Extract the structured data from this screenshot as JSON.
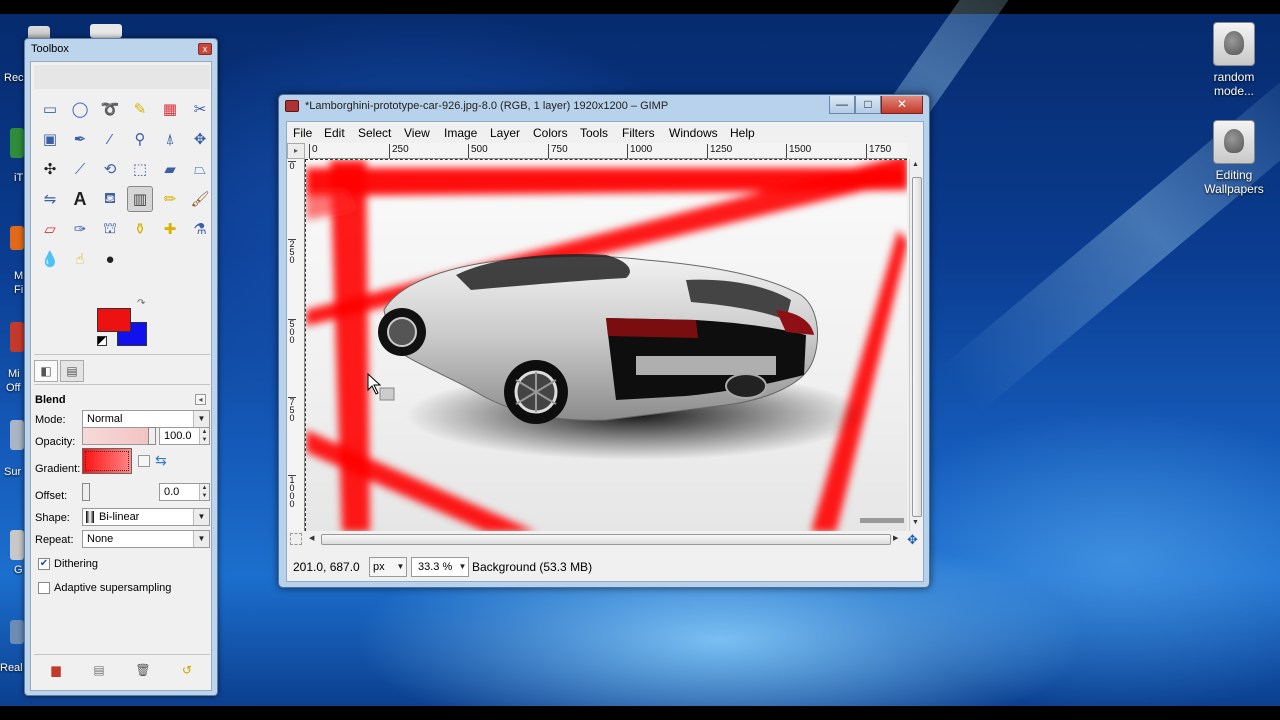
{
  "desktop": {
    "icons": [
      {
        "label_line1": "random",
        "label_line2": "mode...",
        "icon": "gimp-file-icon"
      },
      {
        "label_line1": "Editing",
        "label_line2": "Wallpapers",
        "icon": "gimp-file-icon"
      }
    ],
    "edge_labels": [
      "Rec",
      "iT",
      "M",
      "Fi",
      "Mi",
      "Off",
      "Sur",
      "G",
      "Real"
    ]
  },
  "toolbox": {
    "title": "Toolbox",
    "close_label": "x",
    "tools": [
      "rect-select-icon",
      "ellipse-select-icon",
      "free-select-icon",
      "fuzzy-select-icon",
      "select-by-color-icon",
      "scissors-select-icon",
      "foreground-select-icon",
      "paths-icon",
      "color-picker-icon",
      "zoom-icon",
      "measure-icon",
      "move-icon",
      "alignment-icon",
      "crop-icon",
      "rotate-icon",
      "scale-icon",
      "shear-icon",
      "perspective-icon",
      "flip-icon",
      "text-icon",
      "bucket-fill-icon",
      "blend-icon",
      "pencil-icon",
      "paintbrush-icon",
      "eraser-icon",
      "airbrush-icon",
      "ink-icon",
      "clone-icon",
      "heal-icon",
      "perspective-clone-icon",
      "blur-icon",
      "smudge-icon",
      "dodge-burn-icon"
    ],
    "active_tool": "blend-icon",
    "colors": {
      "foreground": "#ee1111",
      "background": "#1111ee"
    },
    "options": {
      "title": "Blend",
      "mode_label": "Mode:",
      "mode_value": "Normal",
      "opacity_label": "Opacity:",
      "opacity_value": "100.0",
      "gradient_label": "Gradient:",
      "offset_label": "Offset:",
      "offset_value": "0.0",
      "shape_label": "Shape:",
      "shape_value": "Bi-linear",
      "repeat_label": "Repeat:",
      "repeat_value": "None",
      "dithering_label": "Dithering",
      "dithering_checked": true,
      "adaptive_label": "Adaptive supersampling",
      "adaptive_checked": false
    }
  },
  "gimp_window": {
    "title": "*Lamborghini-prototype-car-926.jpg-8.0 (RGB, 1 layer) 1920x1200 – GIMP",
    "controls": {
      "minimize": "—",
      "maximize": "□",
      "close": "✕"
    },
    "menu": [
      "File",
      "Edit",
      "Select",
      "View",
      "Image",
      "Layer",
      "Colors",
      "Tools",
      "Filters",
      "Windows",
      "Help"
    ],
    "ruler_h": [
      "0",
      "250",
      "500",
      "750",
      "1000",
      "1250",
      "1500",
      "1750"
    ],
    "ruler_v": [
      "0",
      "2\n5\n0",
      "5\n0\n0",
      "7\n5\n0",
      "1\n0\n0\n0"
    ],
    "status": {
      "coords": "201.0, 687.0",
      "unit": "px",
      "zoom": "33.3 %",
      "layer": "Background (53.3 MB)"
    }
  }
}
